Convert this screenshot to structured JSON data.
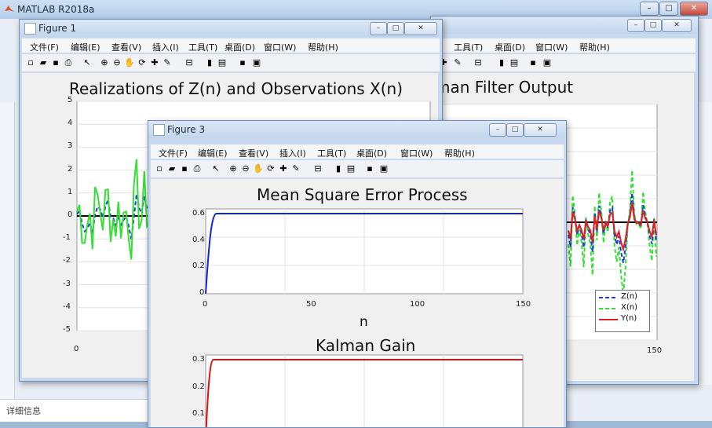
{
  "app": {
    "title": "MATLAB R2018a",
    "detail_label": "详细信息"
  },
  "menu": [
    "文件(F)",
    "编辑(E)",
    "查看(V)",
    "插入(I)",
    "工具(T)",
    "桌面(D)",
    "窗口(W)",
    "帮助(H)"
  ],
  "menu_partial": [
    "工具(T)",
    "桌面(D)",
    "窗口(W)",
    "帮助(H)"
  ],
  "figure1": {
    "title": "Figure 1",
    "axes_title": "Realizations of Z(n) and Observations X(n)",
    "yticks": [
      "5",
      "4",
      "3",
      "2",
      "1",
      "0",
      "-1",
      "-2",
      "-3",
      "-4",
      "-5"
    ],
    "xtick_first": "0"
  },
  "figure2": {
    "axes_title": "man Filter Output",
    "xtick_last": "150",
    "legend": [
      "Z(n)",
      "X(n)",
      "Y(n)"
    ]
  },
  "figure3": {
    "title": "Figure 3",
    "mse_title": "Mean Square Error Process",
    "mse_yticks": [
      "0.6",
      "0.4",
      "0.2",
      "0"
    ],
    "mse_xticks": [
      "0",
      "50",
      "100",
      "150"
    ],
    "mse_xlabel": "n",
    "gain_title": "Kalman Gain",
    "gain_yticks": [
      "0.3",
      "0.2",
      "0.1"
    ]
  },
  "colors": {
    "z": "#1f3fd0",
    "x": "#33e033",
    "y": "#e02020",
    "mse": "#1024d8",
    "gain": "#e01010"
  }
}
